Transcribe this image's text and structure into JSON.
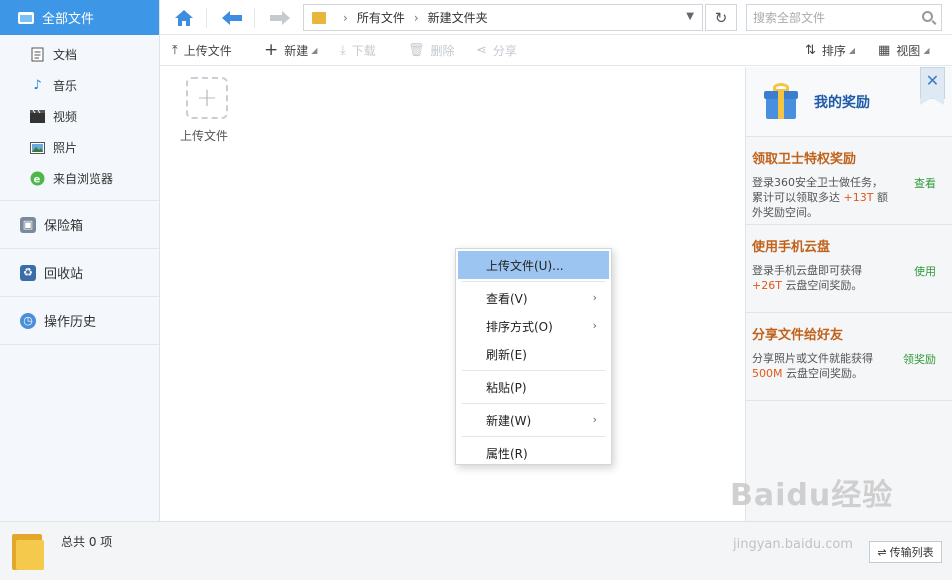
{
  "sidebar": {
    "all_files": "全部文件",
    "sub_items": [
      {
        "label": "文档",
        "icon": "document-icon"
      },
      {
        "label": "音乐",
        "icon": "music-icon"
      },
      {
        "label": "视频",
        "icon": "video-icon"
      },
      {
        "label": "照片",
        "icon": "photo-icon"
      },
      {
        "label": "来自浏览器",
        "icon": "browser-icon"
      }
    ],
    "main_items": [
      {
        "label": "保险箱",
        "icon": "safe-icon"
      },
      {
        "label": "回收站",
        "icon": "recycle-bin-icon"
      },
      {
        "label": "操作历史",
        "icon": "history-icon"
      }
    ]
  },
  "topbar": {
    "breadcrumb": [
      "所有文件",
      "新建文件夹"
    ],
    "search_placeholder": "搜索全部文件"
  },
  "toolbar": {
    "upload": "上传文件",
    "new": "新建",
    "download": "下载",
    "delete": "删除",
    "share": "分享",
    "sort": "排序",
    "view": "视图"
  },
  "content": {
    "upload_tile": "上传文件"
  },
  "context_menu": {
    "items": [
      {
        "label": "上传文件(U)...",
        "highlighted": true
      },
      {
        "label": "查看(V)",
        "submenu": true
      },
      {
        "label": "排序方式(O)",
        "submenu": true
      },
      {
        "label": "刷新(E)"
      },
      {
        "label": "粘贴(P)"
      },
      {
        "label": "新建(W)",
        "submenu": true
      },
      {
        "label": "属性(R)"
      }
    ]
  },
  "rewards": {
    "title": "我的奖励",
    "items": [
      {
        "title": "领取卫士特权奖励",
        "desc_pre": "登录360安全卫士做任务，累计可以领取多达",
        "desc_hl": "+13T",
        "desc_post": "额外奖励空间。",
        "action": "查看"
      },
      {
        "title": "使用手机云盘",
        "desc_pre": "登录手机云盘即可获得",
        "desc_hl": "+26T",
        "desc_post": "云盘空间奖励。",
        "action": "使用"
      },
      {
        "title": "分享文件给好友",
        "desc_pre": "分享照片或文件就能获得",
        "desc_hl": "500M",
        "desc_post": "云盘空间奖励。",
        "action": "领奖励"
      }
    ]
  },
  "bottombar": {
    "total": "总共 0 项",
    "transfer": "传输列表"
  },
  "watermark": {
    "logo": "Baidu经验",
    "url": "jingyan.baidu.com"
  }
}
